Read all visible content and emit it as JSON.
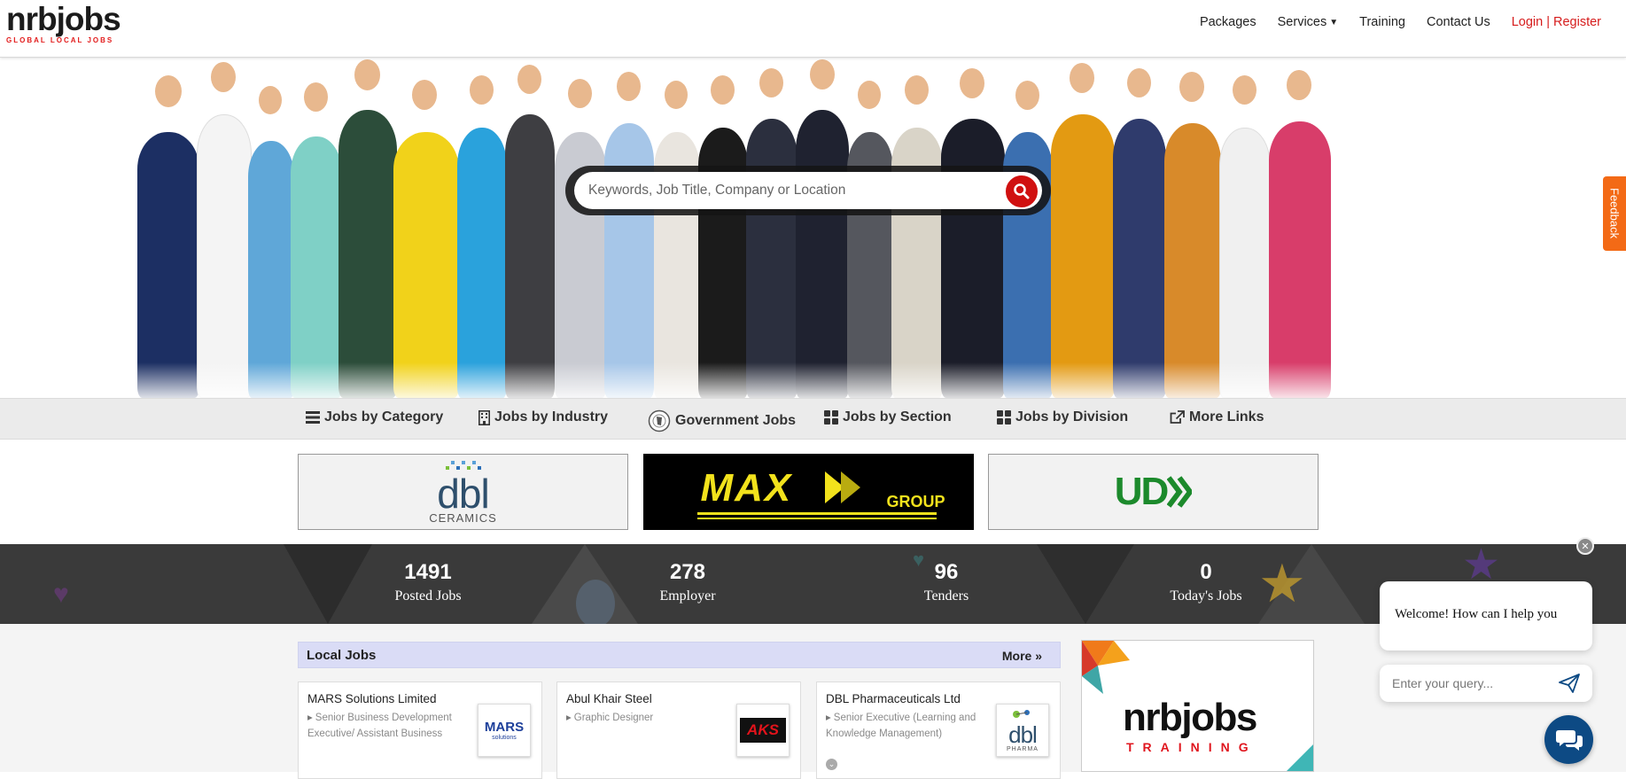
{
  "header": {
    "logo_main": "nrbjobs",
    "logo_sub": "GLOBAL LOCAL JOBS",
    "nav": {
      "packages": "Packages",
      "services": "Services",
      "training": "Training",
      "contact": "Contact Us",
      "login": "Login",
      "separator": "|",
      "register": "Register"
    }
  },
  "hero": {
    "search_placeholder": "Keywords, Job Title, Company or Location"
  },
  "feedback_label": "Feedback",
  "categories": {
    "by_category": "Jobs by Category",
    "by_industry": "Jobs by Industry",
    "government": "Government Jobs",
    "by_section": "Jobs by Section",
    "by_division": "Jobs by Division",
    "more_links": "More Links"
  },
  "banners": {
    "b1_main": "dbl",
    "b1_sub": "CERAMICS",
    "b2_main": "MAX",
    "b2_sub": "GROUP",
    "b3_main": "UD"
  },
  "stats": [
    {
      "value": "1491",
      "label": "Posted Jobs"
    },
    {
      "value": "278",
      "label": "Employer"
    },
    {
      "value": "96",
      "label": "Tenders"
    },
    {
      "value": "0",
      "label": "Today's Jobs"
    }
  ],
  "local_jobs": {
    "title": "Local Jobs",
    "more": "More",
    "jobs": [
      {
        "company": "MARS Solutions Limited",
        "position": "Senior Business Development Executive/ Assistant Business",
        "logo_text": "MARS",
        "logo_sub": "solutions"
      },
      {
        "company": "Abul Khair Steel",
        "position": "Graphic Designer",
        "logo_text": "AKS",
        "logo_sub": ""
      },
      {
        "company": "DBL Pharmaceuticals Ltd",
        "position": "Senior Executive (Learning and Knowledge Management)",
        "logo_text": "dbl",
        "logo_sub": "PHARMA"
      }
    ]
  },
  "training_ad": {
    "logo": "nrbjobs",
    "sub": "TRAINING"
  },
  "chat": {
    "welcome": "Welcome! How can I help you",
    "input_placeholder": "Enter your query..."
  },
  "colors": {
    "brand_red": "#d01010",
    "feedback_orange": "#f36a16",
    "local_jobs_header": "#dadcf6",
    "chat_blue": "#0d4a84"
  }
}
